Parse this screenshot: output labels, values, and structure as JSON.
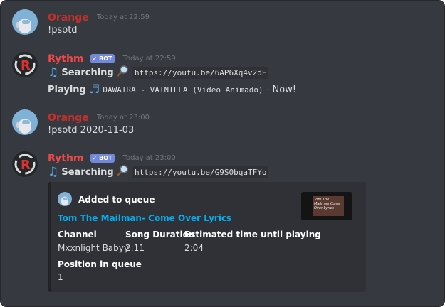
{
  "colors": {
    "orange_user": "#c4302b",
    "rythm_user": "#f04747",
    "bot_badge": "#7289da",
    "link": "#00b0f4",
    "note": "#55acee"
  },
  "messages": [
    {
      "author": "Orange",
      "timestamp": "Today at 22:59",
      "content": "!psotd"
    },
    {
      "author": "Rythm",
      "badge": "✓ BOT",
      "timestamp": "Today at 22:59",
      "line1": {
        "emoji": "music-note-icon",
        "label": "Searching",
        "icon": "magnifier-icon",
        "url": "https://youtu.be/6AP6Xq4v2dE"
      },
      "line2": {
        "label": "Playing",
        "emoji": "music-notes-icon",
        "track": "DAWAIRA - VAINILLA (Video Animado)",
        "suffix": " - Now!"
      }
    },
    {
      "author": "Orange",
      "timestamp": "Today at 23:00",
      "content": "!psotd 2020-11-03"
    },
    {
      "author": "Rythm",
      "badge": "✓ BOT",
      "timestamp": "Today at 23:00",
      "line1": {
        "emoji": "music-note-icon",
        "label": "Searching",
        "icon": "magnifier-icon",
        "url": "https://youtu.be/G9S0bqaTFYo"
      },
      "embed": {
        "author": "Added to queue",
        "title": "Tom The Mailman- Come Over Lyrics",
        "thumbnail_text": "Tom The Mailman Come Over Lyrics",
        "fields": [
          {
            "name": "Channel",
            "value": "Mxxnlight Babyy"
          },
          {
            "name": "Song Duration",
            "value": "2:11"
          },
          {
            "name": "Estimated time until playing",
            "value": "2:04"
          },
          {
            "name": "Position in queue",
            "value": "1"
          }
        ]
      }
    }
  ]
}
